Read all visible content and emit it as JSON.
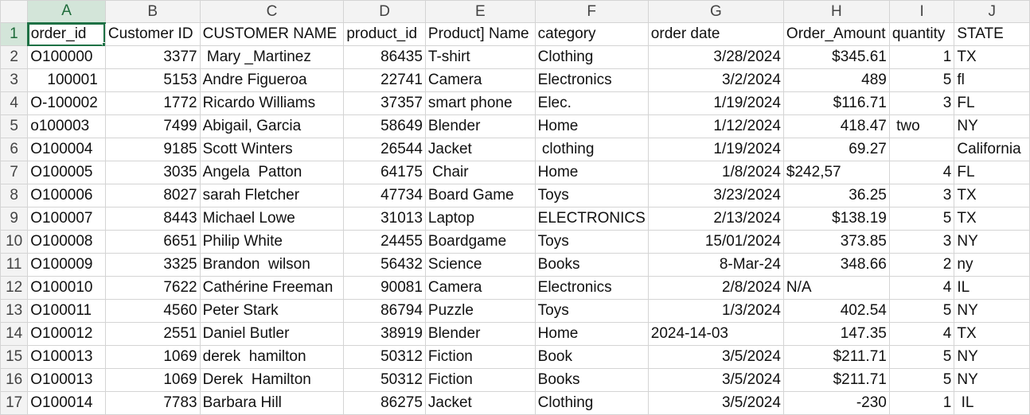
{
  "columns": [
    "A",
    "B",
    "C",
    "D",
    "E",
    "F",
    "G",
    "H",
    "I",
    "J"
  ],
  "active_column": "A",
  "active_cell": "A1",
  "rows": [
    {
      "n": "1",
      "cells": [
        "order_id",
        "Customer ID",
        "CUSTOMER NAME",
        "product_id",
        "Product] Name",
        "category",
        "order date",
        "Order_Amount",
        "quantity",
        "STATE"
      ]
    },
    {
      "n": "2",
      "cells": [
        "O100000",
        "3377",
        " Mary _Martinez",
        "86435",
        "T-shirt",
        "Clothing",
        "3/28/2024",
        "$345.61",
        "1",
        "TX"
      ]
    },
    {
      "n": "3",
      "cells": [
        "    100001",
        "5153",
        "Andre Figueroa",
        "22741",
        "Camera",
        "Electronics",
        "3/2/2024",
        "489",
        "5",
        "fl"
      ]
    },
    {
      "n": "4",
      "cells": [
        "O-100002",
        "1772",
        "Ricardo Williams",
        "37357",
        "smart phone",
        "Elec.",
        "1/19/2024",
        "$116.71",
        "3",
        "FL"
      ]
    },
    {
      "n": "5",
      "cells": [
        "o100003",
        "7499",
        "Abigail, Garcia",
        "58649",
        "Blender",
        "Home",
        "1/12/2024",
        "418.47",
        " two",
        "NY"
      ]
    },
    {
      "n": "6",
      "cells": [
        "O100004",
        "9185",
        "Scott Winters",
        "26544",
        "Jacket",
        " clothing",
        "1/19/2024",
        "69.27",
        "",
        "California"
      ]
    },
    {
      "n": "7",
      "cells": [
        "O100005",
        "3035",
        "Angela  Patton",
        "64175",
        " Chair",
        "Home",
        "1/8/2024",
        "$242,57",
        "4",
        "FL"
      ]
    },
    {
      "n": "8",
      "cells": [
        "O100006",
        "8027",
        "sarah Fletcher",
        "47734",
        "Board Game",
        "Toys",
        "3/23/2024",
        "36.25",
        "3",
        "TX"
      ]
    },
    {
      "n": "9",
      "cells": [
        "O100007",
        "8443",
        "Michael Lowe",
        "31013",
        "Laptop",
        "ELECTRONICS",
        "2/13/2024",
        "$138.19",
        "5",
        "TX"
      ]
    },
    {
      "n": "10",
      "cells": [
        "O100008",
        "6651",
        "Philip White",
        "24455",
        "Boardgame",
        "Toys",
        "15/01/2024",
        "373.85",
        "3",
        "NY"
      ]
    },
    {
      "n": "11",
      "cells": [
        "O100009",
        "3325",
        "Brandon  wilson",
        "56432",
        "Science",
        "Books",
        "8-Mar-24",
        "348.66",
        "2",
        "ny"
      ]
    },
    {
      "n": "12",
      "cells": [
        "O100010",
        "7622",
        "Cathérine Freeman",
        "90081",
        "Camera",
        "Electronics",
        "2/8/2024",
        "N/A",
        "4",
        "IL"
      ]
    },
    {
      "n": "13",
      "cells": [
        "O100011",
        "4560",
        "Peter Stark",
        "86794",
        "Puzzle",
        "Toys",
        "1/3/2024",
        "402.54",
        "5",
        "NY"
      ]
    },
    {
      "n": "14",
      "cells": [
        "O100012",
        "2551",
        "Daniel Butler",
        "38919",
        "Blender",
        "Home",
        "2024-14-03",
        "147.35",
        "4",
        "TX"
      ]
    },
    {
      "n": "15",
      "cells": [
        "O100013",
        "1069",
        "derek  hamilton",
        "50312",
        "Fiction",
        "Book",
        "3/5/2024",
        "$211.71",
        "5",
        "NY"
      ]
    },
    {
      "n": "16",
      "cells": [
        "O100013",
        "1069",
        "Derek  Hamilton",
        "50312",
        "Fiction",
        "Books",
        "3/5/2024",
        "$211.71",
        "5",
        "NY"
      ]
    },
    {
      "n": "17",
      "cells": [
        "O100014",
        "7783",
        "Barbara Hill",
        "86275",
        "Jacket",
        "Clothing",
        "3/5/2024",
        "-230",
        "1",
        " IL"
      ]
    }
  ]
}
